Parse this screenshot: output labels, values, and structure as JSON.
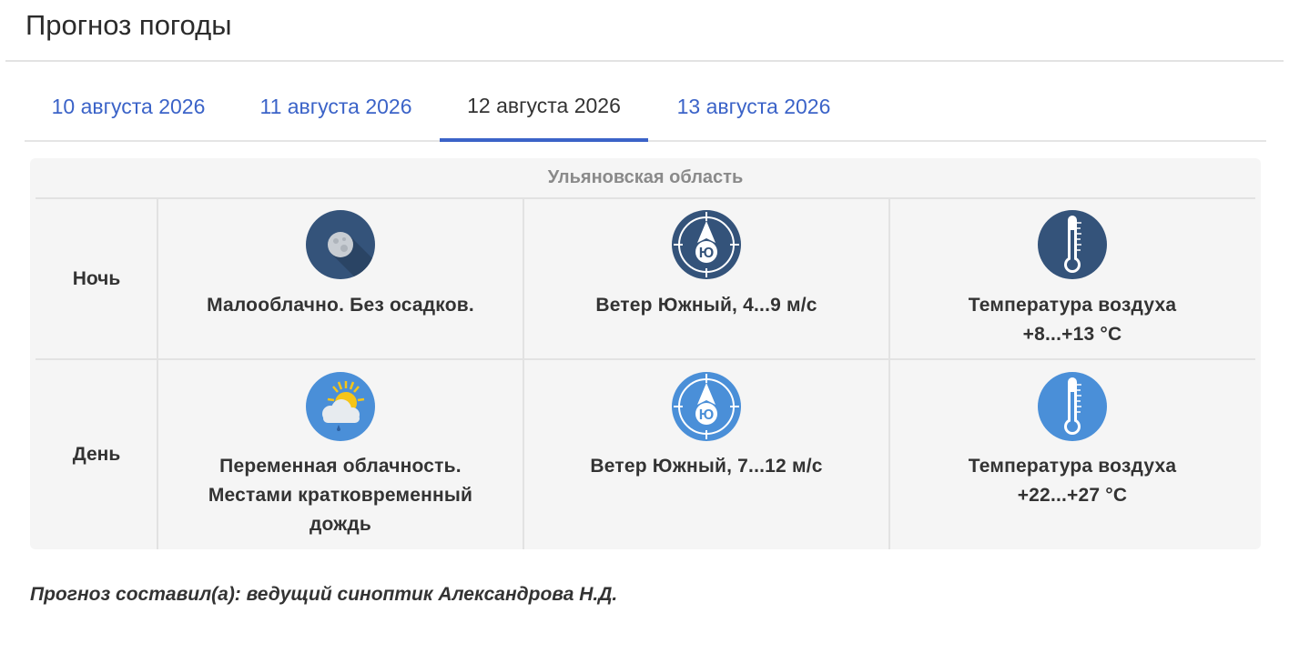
{
  "page": {
    "title": "Прогноз погоды"
  },
  "tabs": [
    {
      "label": "10 августа 2026",
      "active": false
    },
    {
      "label": "11 августа 2026",
      "active": false
    },
    {
      "label": "12 августа 2026",
      "active": true
    },
    {
      "label": "13 августа 2026",
      "active": false
    }
  ],
  "forecast": {
    "region": "Ульяновская область",
    "night": {
      "label": "Ночь",
      "weather": {
        "icon": "moon-icon",
        "text": "Малооблачно. Без осадков."
      },
      "wind": {
        "icon": "wind-south-icon",
        "letter": "Ю",
        "text": "Ветер Южный, 4...9 м/с"
      },
      "temperature": {
        "icon": "thermometer-icon",
        "line1": "Температура воздуха",
        "line2": "+8...+13 °C"
      }
    },
    "day": {
      "label": "День",
      "weather": {
        "icon": "sun-cloud-rain-icon",
        "line1": "Переменная облачность.",
        "line2": "Местами кратковременный",
        "line3": "дождь"
      },
      "wind": {
        "icon": "wind-south-icon",
        "letter": "Ю",
        "text": "Ветер Южный, 7...12 м/с"
      },
      "temperature": {
        "icon": "thermometer-icon",
        "line1": "Температура воздуха",
        "line2": "+22...+27 °C"
      }
    }
  },
  "footer": {
    "author": "Прогноз составил(а): ведущий синоптик Александрова Н.Д."
  },
  "colors": {
    "link": "#3b63c8",
    "night_icon_bg": "#34537a",
    "day_icon_bg": "#4a8fd8"
  }
}
